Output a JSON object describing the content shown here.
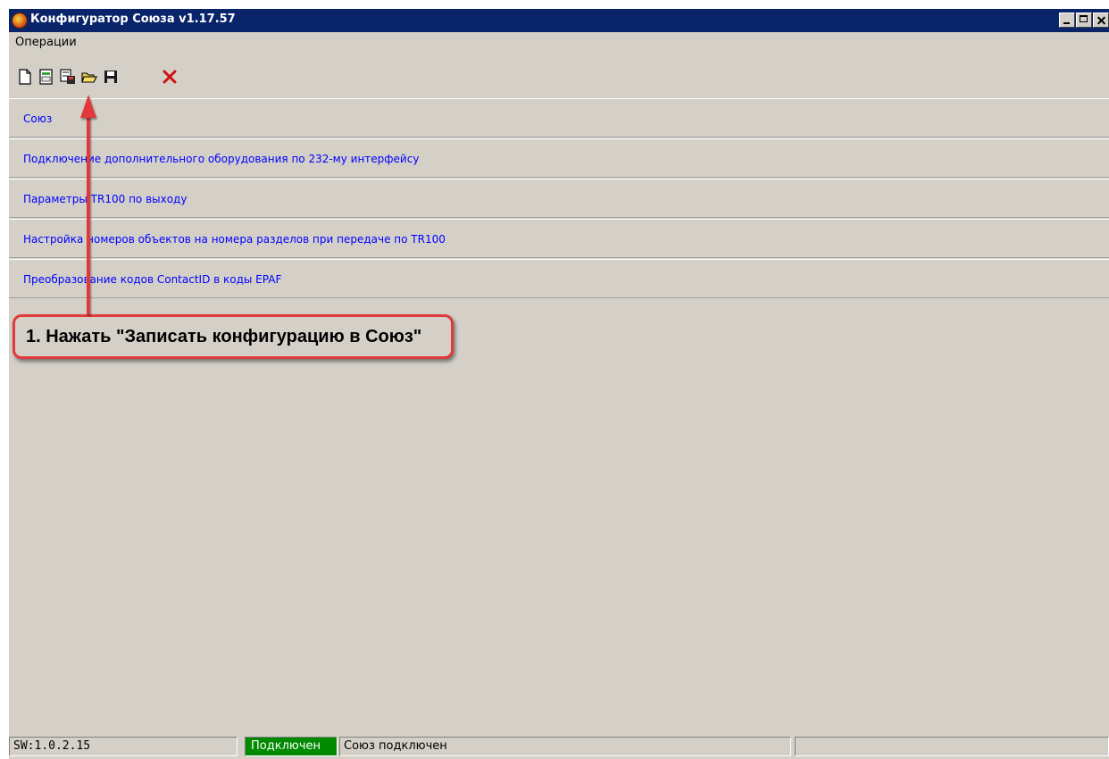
{
  "window": {
    "title": "Конфигуратор Союза v1.17.57"
  },
  "menu": {
    "items": [
      "Операции"
    ]
  },
  "toolbar": {
    "buttons": [
      {
        "icon": "new-document-icon"
      },
      {
        "icon": "read-config-icon"
      },
      {
        "icon": "write-config-icon"
      },
      {
        "icon": "open-folder-icon"
      },
      {
        "icon": "save-icon"
      },
      {
        "icon": "delete-icon"
      }
    ]
  },
  "panels": [
    {
      "label": "Союз"
    },
    {
      "label": "Подключение дополнительного оборудования по 232-му интерфейсу"
    },
    {
      "label": "Параметры TR100 по выходу"
    },
    {
      "label": "Настройка номеров объектов на номера разделов при передаче по TR100"
    },
    {
      "label": "Преобразование кодов ContactID в коды EPAF"
    }
  ],
  "annotation": {
    "text": "1. Нажать \"Записать конфигурацию в Союз\"",
    "color": "#e03a3a"
  },
  "statusbar": {
    "software": "SW:1.0.2.15",
    "connection": "Подключен",
    "message": "Союз подключен",
    "connection_color": "#008a00"
  }
}
